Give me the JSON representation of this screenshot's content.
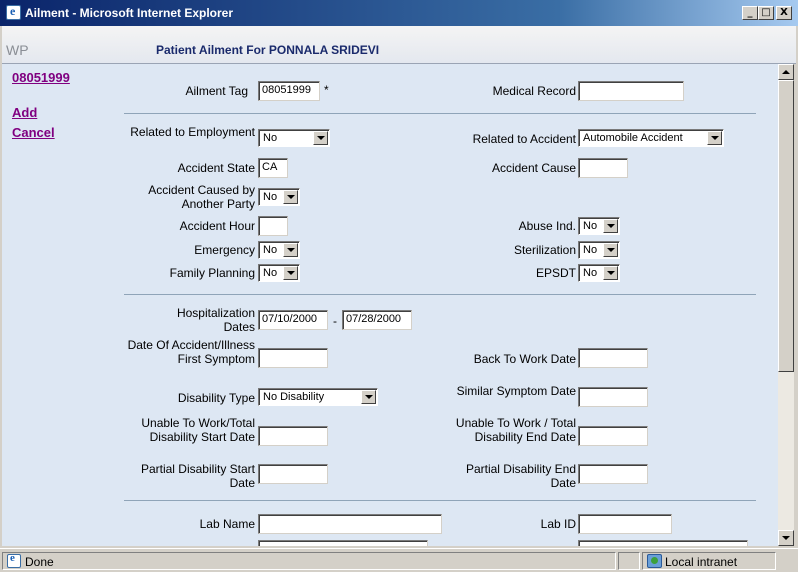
{
  "window": {
    "title": "Ailment - Microsoft Internet Explorer",
    "minimize": "_",
    "maximize": "□",
    "close": "X"
  },
  "header": {
    "logo": "WP",
    "title": "Patient Ailment For PONNALA SRIDEVI"
  },
  "sidebar": {
    "record_link": "08051999",
    "add": "Add",
    "cancel": "Cancel"
  },
  "form": {
    "ailment_tag": {
      "label": "Ailment Tag",
      "value": "08051999",
      "required_mark": "*"
    },
    "medical_record": {
      "label": "Medical Record",
      "value": ""
    },
    "related_employment": {
      "label": "Related to Employment",
      "value": "No"
    },
    "related_accident": {
      "label": "Related to Accident",
      "value": "Automobile Accident"
    },
    "accident_state": {
      "label": "Accident State",
      "value": "CA"
    },
    "accident_cause": {
      "label": "Accident Cause",
      "value": ""
    },
    "caused_by_other": {
      "label": "Accident Caused by Another Party",
      "value": "No"
    },
    "accident_hour": {
      "label": "Accident Hour",
      "value": ""
    },
    "abuse_ind": {
      "label": "Abuse Ind.",
      "value": "No"
    },
    "emergency": {
      "label": "Emergency",
      "value": "No"
    },
    "sterilization": {
      "label": "Sterilization",
      "value": "No"
    },
    "family_planning": {
      "label": "Family Planning",
      "value": "No"
    },
    "epsdt": {
      "label": "EPSDT",
      "value": "No"
    },
    "hospitalization": {
      "label": "Hospitalization Dates",
      "from": "07/10/2000",
      "dash": "-",
      "to": "07/28/2000"
    },
    "first_symptom": {
      "label": "Date Of Accident/Illness First Symptom",
      "value": ""
    },
    "back_to_work": {
      "label": "Back To Work Date",
      "value": ""
    },
    "disability_type": {
      "label": "Disability Type",
      "value": "No Disability"
    },
    "similar_symptom": {
      "label": "Similar Symptom Date",
      "value": ""
    },
    "unable_start": {
      "label": "Unable To Work/Total Disability Start Date",
      "value": ""
    },
    "unable_end": {
      "label": "Unable To Work / Total Disability End Date",
      "value": ""
    },
    "partial_start": {
      "label": "Partial Disability Start Date",
      "value": ""
    },
    "partial_end": {
      "label": "Partial Disability End Date",
      "value": ""
    },
    "lab_name": {
      "label": "Lab Name",
      "value": ""
    },
    "lab_id": {
      "label": "Lab ID",
      "value": ""
    }
  },
  "statusbar": {
    "status": "Done",
    "zone": "Local intranet"
  }
}
